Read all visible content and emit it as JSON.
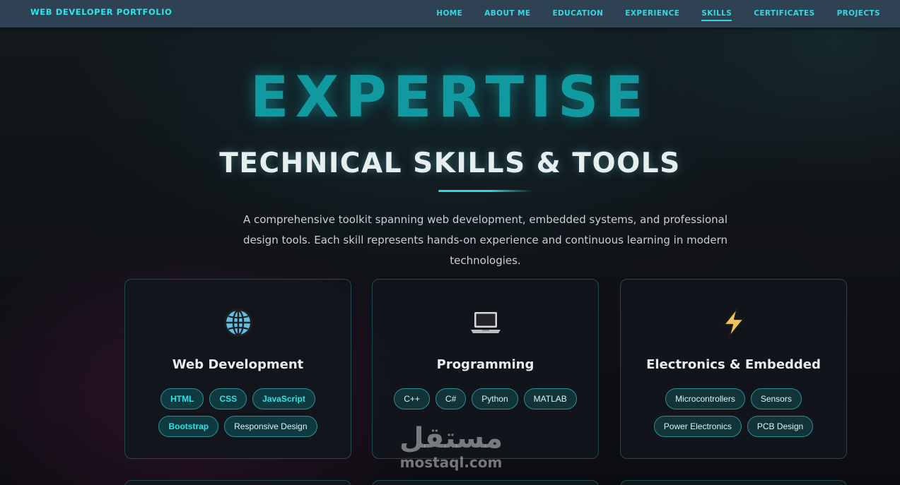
{
  "brand": "WEB DEVELOPER PORTFOLIO",
  "nav": [
    {
      "label": "HOME",
      "active": false
    },
    {
      "label": "ABOUT ME",
      "active": false
    },
    {
      "label": "EDUCATION",
      "active": false
    },
    {
      "label": "EXPERIENCE",
      "active": false
    },
    {
      "label": "SKILLS",
      "active": true
    },
    {
      "label": "CERTIFICATES",
      "active": false
    },
    {
      "label": "PROJECTS",
      "active": false
    }
  ],
  "hero": {
    "title": "EXPERTISE",
    "subtitle": "TECHNICAL SKILLS & TOOLS",
    "description": "A comprehensive toolkit spanning web development, embedded systems, and professional design tools. Each skill represents hands-on experience and continuous learning in modern technologies."
  },
  "cards": [
    {
      "icon": "globe-icon",
      "title": "Web Development",
      "tags": [
        "HTML",
        "CSS",
        "JavaScript",
        "Bootstrap",
        "Responsive Design"
      ]
    },
    {
      "icon": "laptop-icon",
      "title": "Programming",
      "tags": [
        "C++",
        "C#",
        "Python",
        "MATLAB"
      ]
    },
    {
      "icon": "lightning-icon",
      "title": "Electronics & Embedded",
      "tags": [
        "Microcontrollers",
        "Sensors",
        "Power Electronics",
        "PCB Design"
      ]
    }
  ],
  "watermark": {
    "arabic": "مستقل",
    "latin": "mostaql.com"
  },
  "colors": {
    "accent": "#2ee6ea",
    "navbar": "#2e4254",
    "title": "#109aa0"
  }
}
